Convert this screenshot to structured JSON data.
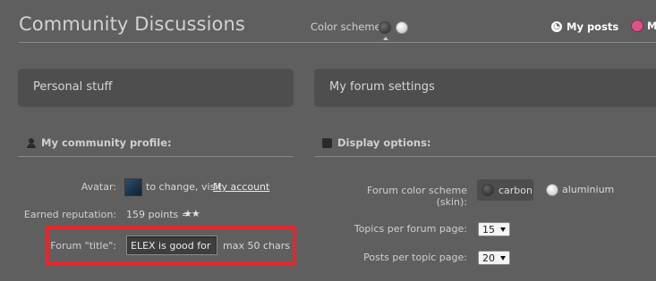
{
  "header": {
    "title": "Community Discussions",
    "color_scheme_label": "Color scheme",
    "my_posts": "My posts",
    "messages_partial": "M"
  },
  "tabs": {
    "personal": "Personal stuff",
    "forum_settings": "My forum settings"
  },
  "profile": {
    "section_title": "My community profile:",
    "avatar_label": "Avatar:",
    "avatar_text": "to change, visit",
    "avatar_link": "My account",
    "reputation_label": "Earned reputation:",
    "reputation_value": "159 points =",
    "reputation_stars": "★★",
    "forum_title_label": "Forum \"title\":",
    "forum_title_value": "ELEX is good for yo",
    "forum_title_hint": "max 50 chars"
  },
  "display": {
    "section_title": "Display options:",
    "skin_label": "Forum color scheme (skin):",
    "skin_options": [
      "carbon",
      "aluminium"
    ],
    "topics_label": "Topics per forum page:",
    "topics_value": "15",
    "posts_label": "Posts per topic page:",
    "posts_value": "20"
  },
  "colors": {
    "background": "#5f5f5f",
    "highlight": "#e3282d"
  }
}
